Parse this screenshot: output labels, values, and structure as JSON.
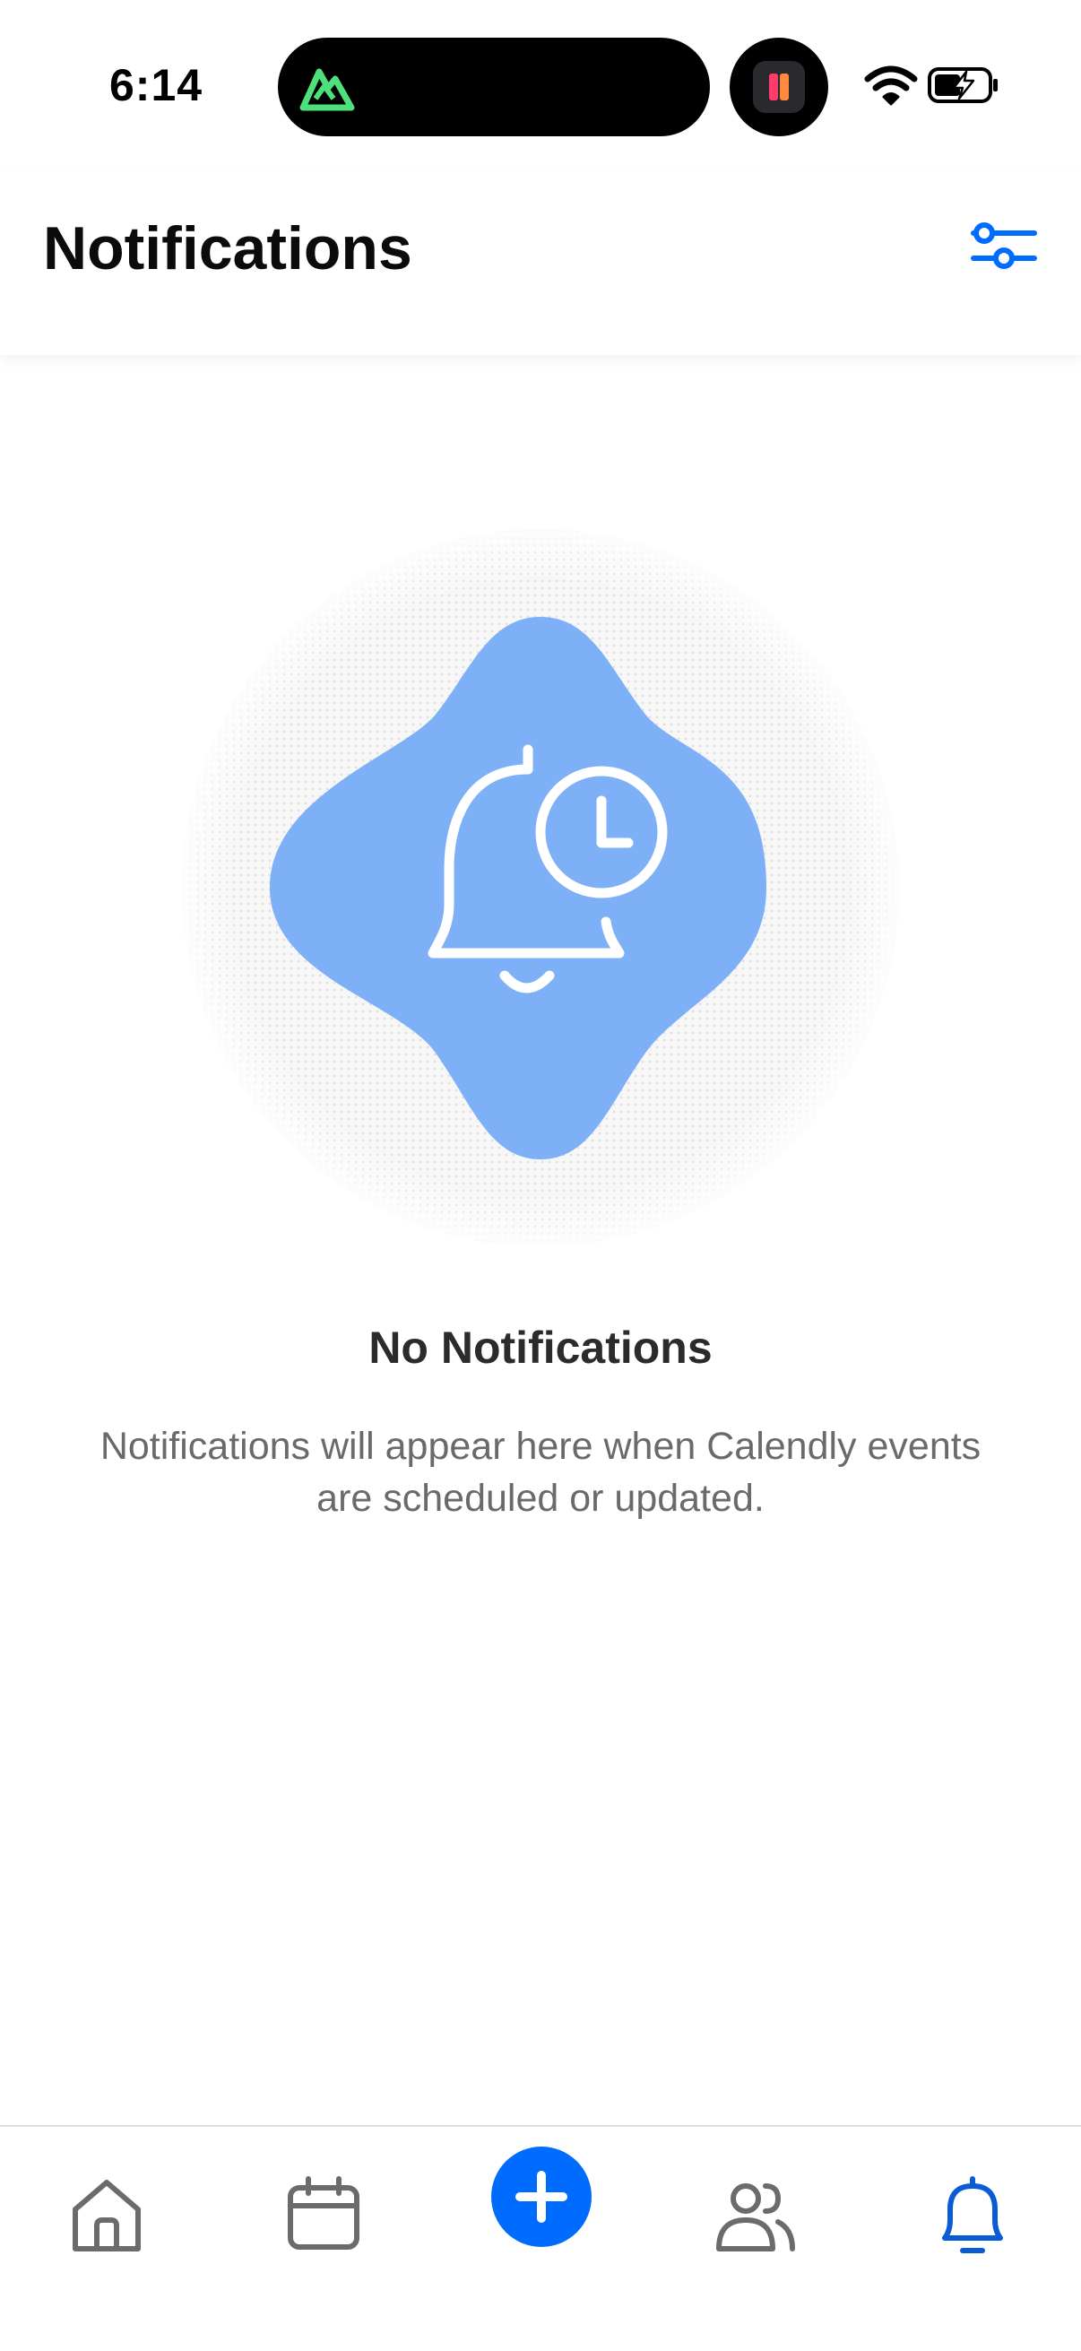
{
  "status_bar": {
    "time": "6:14"
  },
  "header": {
    "title": "Notifications",
    "filter_icon": "sliders-icon"
  },
  "empty_state": {
    "illustration_icon": "bell-clock-icon",
    "title": "No Notifications",
    "message": "Notifications will appear here when Calendly events are scheduled or updated."
  },
  "tab_bar": {
    "items": [
      {
        "icon": "home-icon",
        "active": false
      },
      {
        "icon": "calendar-icon",
        "active": false
      },
      {
        "icon": "plus-icon",
        "active": false
      },
      {
        "icon": "contacts-icon",
        "active": false
      },
      {
        "icon": "bell-icon",
        "active": true
      }
    ]
  },
  "colors": {
    "accent": "#006bff",
    "blob": "#7eb0f7",
    "active_tab": "#0a5bd6",
    "inactive_tab": "#6b6b6b",
    "title_text": "#0b0b0b",
    "body_text": "#6a6a6a"
  }
}
